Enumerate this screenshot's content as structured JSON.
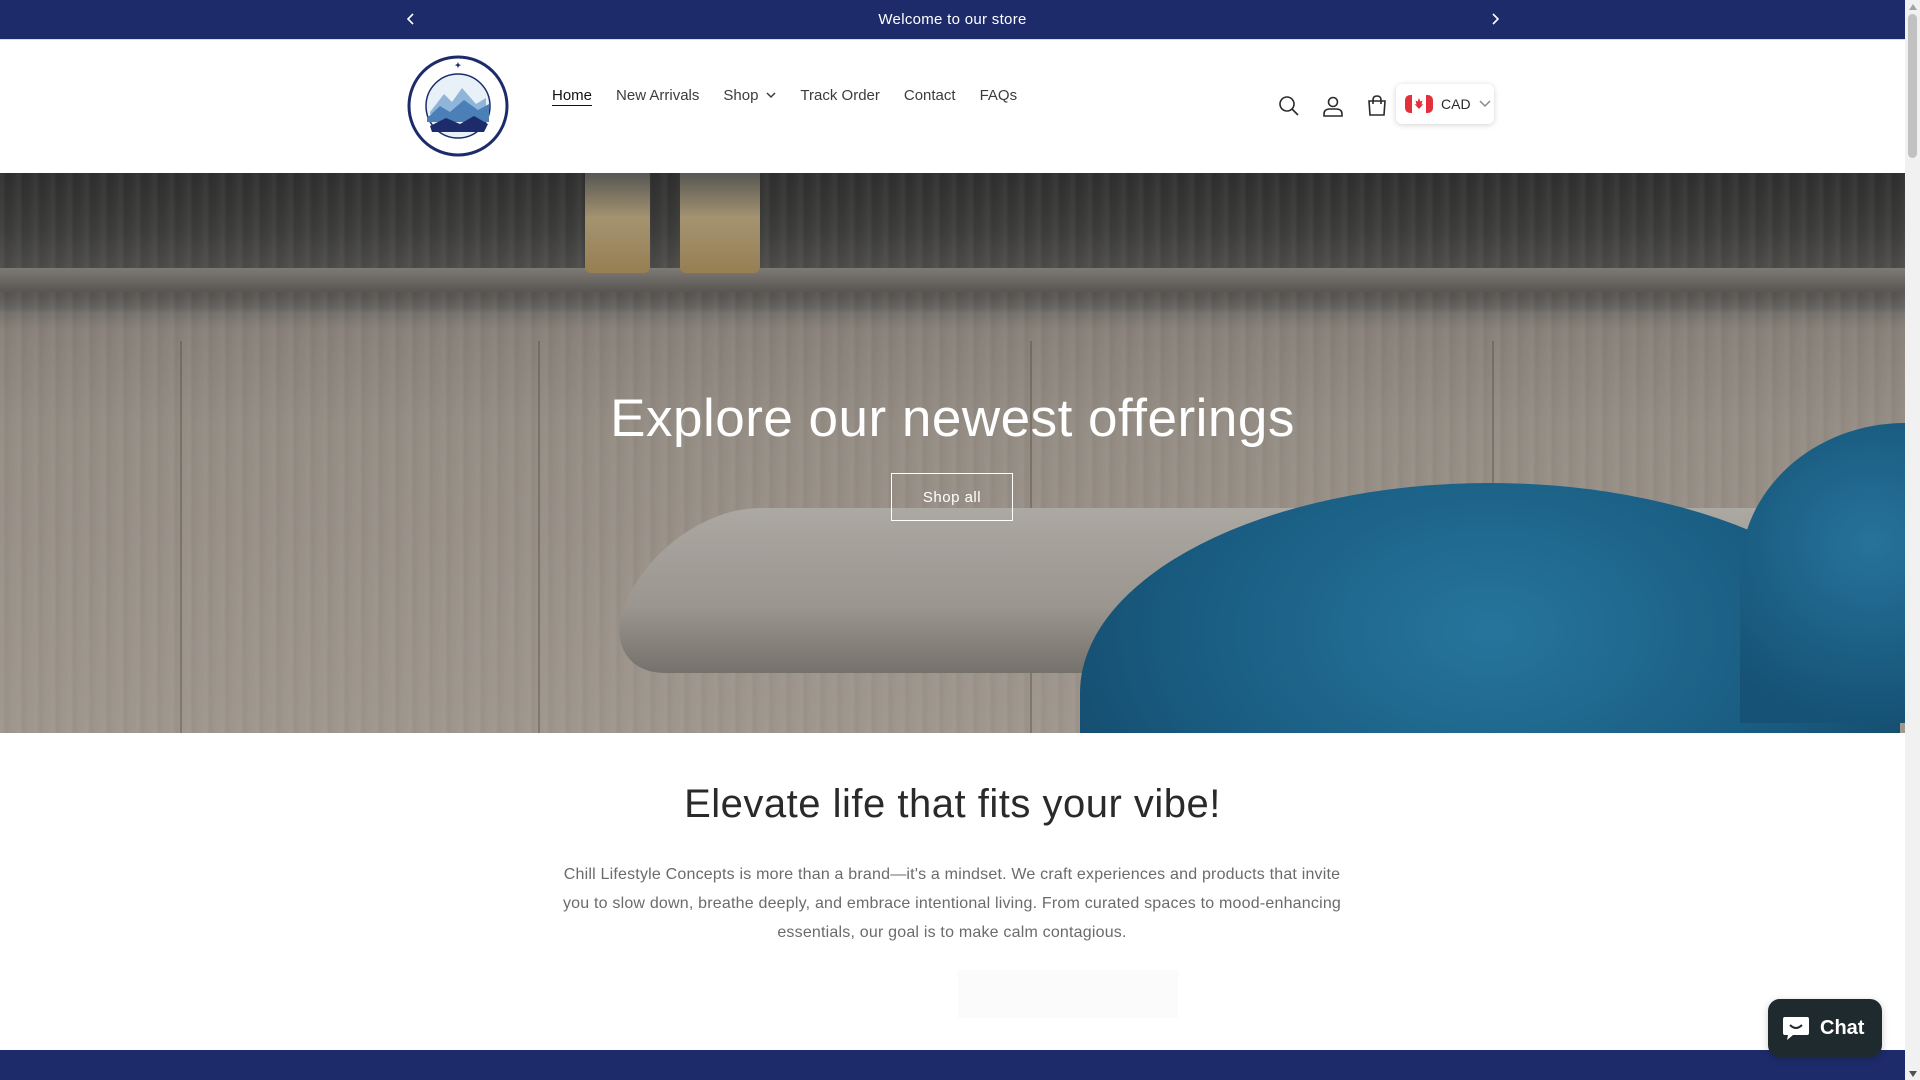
{
  "announcement": {
    "text": "Welcome to our store"
  },
  "header": {
    "nav": [
      {
        "label": "Home",
        "active": true
      },
      {
        "label": "New Arrivals"
      },
      {
        "label": "Shop",
        "dropdown": true
      },
      {
        "label": "Track Order"
      },
      {
        "label": "Contact"
      },
      {
        "label": "FAQs"
      }
    ],
    "icons": [
      "search-icon",
      "account-icon",
      "cart-icon"
    ],
    "currency": {
      "code": "CAD",
      "flag": "canada-flag-icon"
    },
    "logo_icon": "chill-lifestyle-concepts-logo"
  },
  "hero": {
    "title": "Explore our newest offerings",
    "button": "Shop all"
  },
  "intro": {
    "title": "Elevate life that fits your vibe!",
    "text": "Chill Lifestyle Concepts is more than a brand—it's a mindset. We craft experiences and products that invite you to slow down, breathe deeply, and embrace intentional living. From curated spaces to mood-enhancing essentials, our goal is to make calm contagious."
  },
  "chat": {
    "label": "Chat",
    "icon": "chat-bubble-icon"
  },
  "colors": {
    "brand_navy": "#1d2b6b",
    "chat_bg": "#1f2a2e"
  }
}
